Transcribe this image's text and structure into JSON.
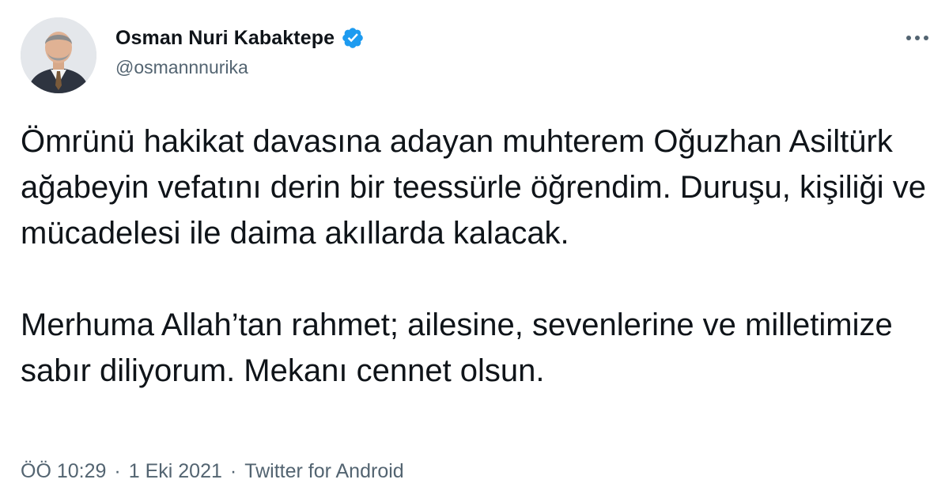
{
  "author": {
    "display_name": "Osman Nuri Kabaktepe",
    "handle": "@osmannnurika",
    "verified": true
  },
  "tweet": {
    "paragraphs": [
      "Ömrünü hakikat davasına adayan muhterem Oğuzhan Asiltürk ağabeyin vefatını derin bir teessürle öğrendim. Duruşu, kişiliği ve mücadelesi ile daima akıllarda kalacak.",
      "Merhuma Allah’tan rahmet; ailesine, sevenlerine ve milletimize sabır diliyorum. Mekanı cennet olsun."
    ]
  },
  "meta": {
    "time": "ÖÖ 10:29",
    "separator": "·",
    "date": "1 Eki 2021",
    "source": "Twitter for Android"
  },
  "icons": {
    "verified": "verified-badge-icon",
    "more": "more-options-icon"
  },
  "colors": {
    "text": "#0f1419",
    "secondary": "#536471",
    "verified": "#1d9bf0"
  }
}
